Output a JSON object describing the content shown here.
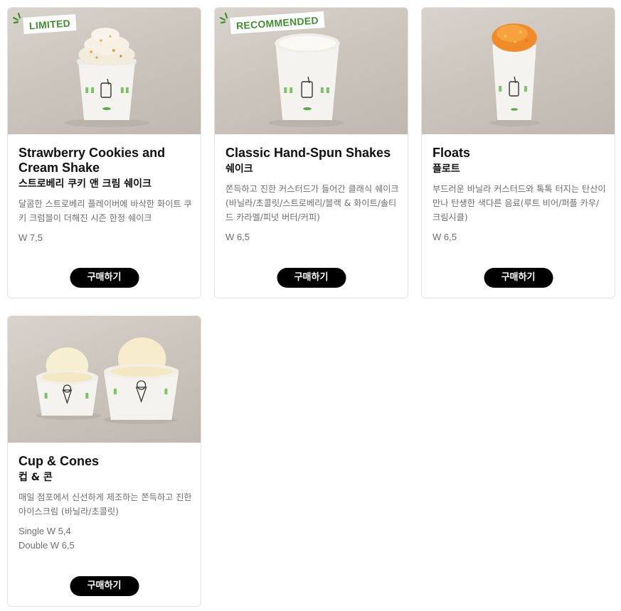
{
  "cards": [
    {
      "badge": "LIMITED",
      "title_en": "Strawberry Cookies and Cream Shake",
      "title_ko": "스트로베리 쿠키 앤 크림 쉐이크",
      "description": "달콤한 스트로베리 플레이버에 바삭한 화이트 쿠키 크럼블이 더해진 시즌 한정 쉐이크",
      "price_lines": [
        "W 7,5"
      ],
      "button": "구매하기"
    },
    {
      "badge": "RECOMMENDED",
      "title_en": "Classic Hand-Spun Shakes",
      "title_ko": "쉐이크",
      "description": "쫀득하고 진한 커스터드가 들어간 클래식 쉐이크(바닐라/초콜릿/스트로베리/블랙 & 화이트/솔티드 카라멜/피넛 버터/커피)",
      "price_lines": [
        "W 6,5"
      ],
      "button": "구매하기"
    },
    {
      "badge": "",
      "title_en": "Floats",
      "title_ko": "플로트",
      "description": "부드러운 바닐라 커스터드와 톡톡 터지는 탄산이 만나 탄생한 색다른 음료(루트 비어/퍼플 카우/크림시클)",
      "price_lines": [
        "W 6,5"
      ],
      "button": "구매하기"
    },
    {
      "badge": "",
      "title_en": "Cup & Cones",
      "title_ko": "컵 & 콘",
      "description": "매일 점포에서 신선하게 제조하는 쫀득하고 진한 아이스크림 (바닐라/초콜릿)",
      "price_lines": [
        "Single W 5,4",
        "Double W 6,5"
      ],
      "button": "구매하기"
    }
  ],
  "colors": {
    "badge_text": "#3f8f2e",
    "button_bg": "#000000",
    "description_text": "#6e6e6e"
  }
}
